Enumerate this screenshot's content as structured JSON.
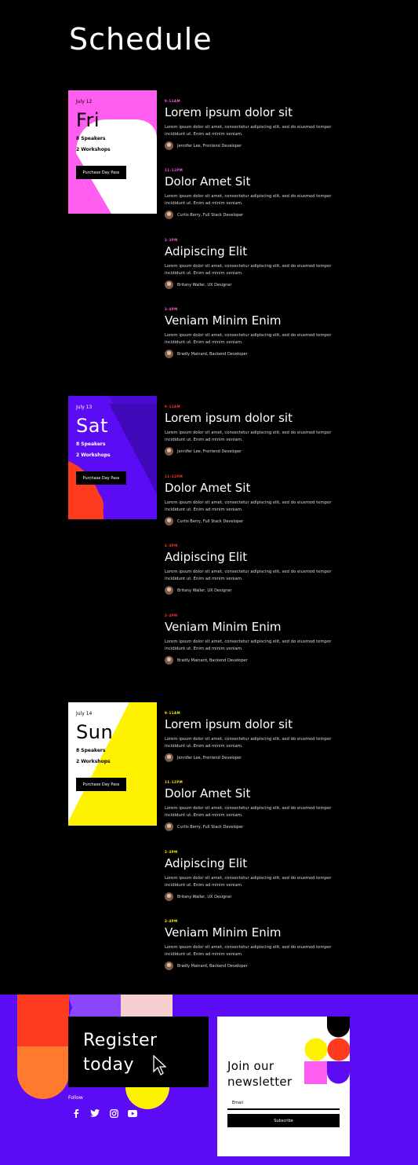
{
  "page": {
    "title": "Schedule"
  },
  "days": [
    {
      "date": "July 12",
      "dow": "Fri",
      "speakers": "8 Speakers",
      "workshops": "2 Workshops",
      "button": "Purchase Day Pass",
      "accent": "#ff5cf0",
      "time_color": "#ff5cf0",
      "sessions": [
        {
          "time": "9-11AM",
          "title": "Lorem ipsum dolor sit",
          "desc": "Lorem ipsum dolor sit amet, consectetur adipiscing elit, sed do eiusmod tempor incididunt ut. Enim ad minim veniam.",
          "speaker": "Jennifer Lee, Frontend Developer"
        },
        {
          "time": "11-12PM",
          "title": "Dolor Amet Sit",
          "desc": "Lorem ipsum dolor sit amet, consectetur adipiscing elit, sed do eiusmod tempor incididunt ut. Enim ad minim veniam.",
          "speaker": "Curtis Berry, Full Stack Developer"
        },
        {
          "time": "2-3PM",
          "title": "Adipiscing Elit",
          "desc": "Lorem ipsum dolor sit amet, consectetur adipiscing elit, sed do eiusmod tempor incididunt ut. Enim ad minim veniam.",
          "speaker": "Britany Waller, UX Designer"
        },
        {
          "time": "3-4PM",
          "title": "Veniam Minim Enim",
          "desc": "Lorem ipsum dolor sit amet, consectetur adipiscing elit, sed do eiusmod tempor incididunt ut. Enim ad minim veniam.",
          "speaker": "Bradly Mainard, Backend Developer"
        }
      ]
    },
    {
      "date": "July 13",
      "dow": "Sat",
      "speakers": "8 Speakers",
      "workshops": "2 Workshops",
      "button": "Purchase Day Pass",
      "accent": "#5b0cf5",
      "time_color": "#ff3b1f",
      "sessions": [
        {
          "time": "9-11AM",
          "title": "Lorem ipsum dolor sit",
          "desc": "Lorem ipsum dolor sit amet, consectetur adipiscing elit, sed do eiusmod tempor incididunt ut. Enim ad minim veniam.",
          "speaker": "Jennifer Lee, Frontend Developer"
        },
        {
          "time": "11-12PM",
          "title": "Dolor Amet Sit",
          "desc": "Lorem ipsum dolor sit amet, consectetur adipiscing elit, sed do eiusmod tempor incididunt ut. Enim ad minim veniam.",
          "speaker": "Curtis Berry, Full Stack Developer"
        },
        {
          "time": "2-3PM",
          "title": "Adipiscing Elit",
          "desc": "Lorem ipsum dolor sit amet, consectetur adipiscing elit, sed do eiusmod tempor incididunt ut. Enim ad minim veniam.",
          "speaker": "Britany Waller, UX Designer"
        },
        {
          "time": "3-4PM",
          "title": "Veniam Minim Enim",
          "desc": "Lorem ipsum dolor sit amet, consectetur adipiscing elit, sed do eiusmod tempor incididunt ut. Enim ad minim veniam.",
          "speaker": "Bradly Mainard, Backend Developer"
        }
      ]
    },
    {
      "date": "July 14",
      "dow": "Sun",
      "speakers": "8 Speakers",
      "workshops": "2 Workshops",
      "button": "Purchase Day Pass",
      "accent": "#fff200",
      "time_color": "#fff200",
      "sessions": [
        {
          "time": "9-11AM",
          "title": "Lorem ipsum dolor sit",
          "desc": "Lorem ipsum dolor sit amet, consectetur adipiscing elit, sed do eiusmod tempor incididunt ut. Enim ad minim veniam.",
          "speaker": "Jennifer Lee, Frontend Developer"
        },
        {
          "time": "11-12PM",
          "title": "Dolor Amet Sit",
          "desc": "Lorem ipsum dolor sit amet, consectetur adipiscing elit, sed do eiusmod tempor incididunt ut. Enim ad minim veniam.",
          "speaker": "Curtis Berry, Full Stack Developer"
        },
        {
          "time": "2-3PM",
          "title": "Adipiscing Elit",
          "desc": "Lorem ipsum dolor sit amet, consectetur adipiscing elit, sed do eiusmod tempor incididunt ut. Enim ad minim veniam.",
          "speaker": "Britany Waller, UX Designer"
        },
        {
          "time": "3-4PM",
          "title": "Veniam Minim Enim",
          "desc": "Lorem ipsum dolor sit amet, consectetur adipiscing elit, sed do eiusmod tempor incididunt ut. Enim ad minim veniam.",
          "speaker": "Bradly Mainard, Backend Developer"
        }
      ]
    }
  ],
  "footer": {
    "register_line1": "Register",
    "register_line2": "today",
    "follow": "Follow",
    "social_icons": [
      "facebook-icon",
      "twitter-icon",
      "instagram-icon",
      "youtube-icon"
    ],
    "newsletter_line1": "Join our",
    "newsletter_line2": "newsletter",
    "email_label": "Email",
    "subscribe": "Subscribe",
    "bg_color": "#5b0cf5"
  }
}
